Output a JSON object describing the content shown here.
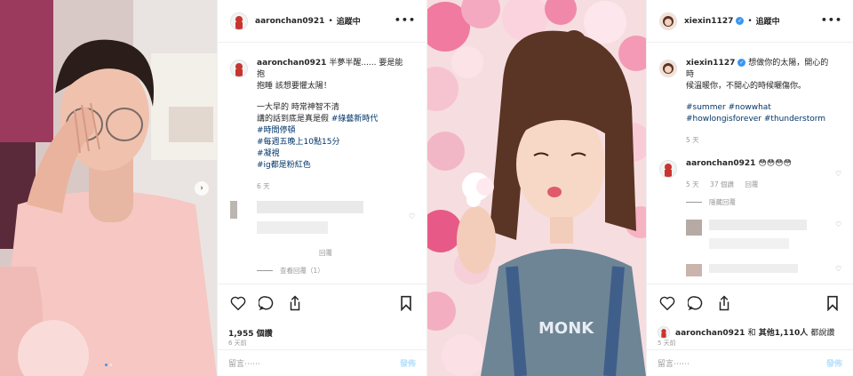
{
  "post1": {
    "header": {
      "username": "aaronchan0921",
      "separator": "•",
      "follow_label": "追蹤中",
      "more_label": "•••"
    },
    "caption": {
      "username": "aaronchan0921",
      "text_line1": "半夢半醒...... 要是能抱",
      "text_line2": "抱睡 該想要懼太陽！",
      "body_line1": "一大早的 時常神智不清",
      "body_line2": "講的話到底是真是假",
      "tag1": "#綠藝新時代",
      "tag2": "#時間停頓",
      "tag3": "#每週五晚上10點15分",
      "tag4": "#凝視",
      "tag5": "#ig都是粉紅色",
      "time": "6 天"
    },
    "comment": {
      "reply_label": "回覆",
      "view_replies": "查看回覆（1）"
    },
    "likes": "1,955 個讚",
    "time_ago": "6 天前",
    "add_comment_placeholder": "留言⋯⋯",
    "post_button": "發佈"
  },
  "post2": {
    "header": {
      "username": "xiexin1127",
      "verified": "✓",
      "separator": "•",
      "follow_label": "追蹤中",
      "more_label": "•••"
    },
    "caption": {
      "username": "xiexin1127",
      "text_line1": "想做你的太陽，開心的時",
      "text_line2": "候溫暖你，不開心的時候曬傷你。",
      "tag1": "#summer",
      "tag2": "#nowwhat",
      "tag3": "#howlongisforever",
      "tag4": "#thunderstorm",
      "time": "5 天"
    },
    "comment1": {
      "username": "aaronchan0921",
      "text": "😳😳😳😳",
      "time": "5 天",
      "likes": "37 個讚",
      "reply_label": "回覆",
      "hide_replies": "隱藏回覆"
    },
    "liked_by": {
      "username": "aaronchan0921",
      "conj": "和",
      "others": "其他1,110人",
      "suffix": "都說讚"
    },
    "time_ago": "5 天前",
    "add_comment_placeholder": "留言⋯⋯",
    "post_button": "發佈"
  },
  "colors": {
    "link": "#003569",
    "accent": "#3897f0",
    "muted": "#999999",
    "post_disabled": "#b2dffc"
  }
}
